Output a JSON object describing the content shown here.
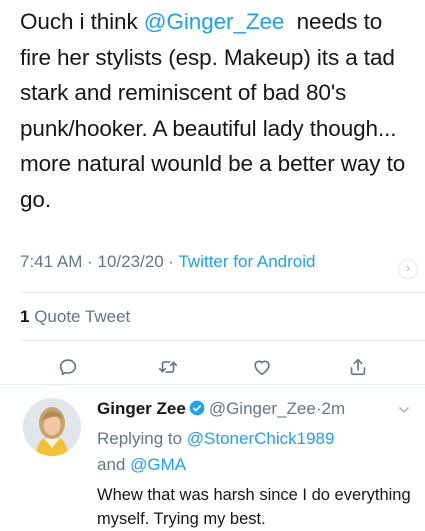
{
  "tweet": {
    "text_line1_pre": "Ouch i think ",
    "mention": "@Ginger_Zee",
    "text_line1_post": "  needs",
    "text_rest": "to fire her stylists (esp. Makeup) its a tad stark and reminiscent of bad 80's punk/hooker. A beautiful lady though... more natural wounld be a better way to go.",
    "time": "7:41 AM",
    "sep1": " · ",
    "date": "10/23/20",
    "sep2": " · ",
    "source": "Twitter for Android",
    "quote_count": "1",
    "quote_label": " Quote Tweet"
  },
  "actions": [
    {
      "name": "reply",
      "icon": "speech-bubble-icon"
    },
    {
      "name": "retweet",
      "icon": "retweet-icon"
    },
    {
      "name": "like",
      "icon": "heart-icon"
    },
    {
      "name": "share",
      "icon": "share-icon"
    }
  ],
  "reply": {
    "name": "Ginger Zee",
    "handle": "@Ginger_Zee",
    "dot": "·",
    "age": "2m",
    "replying_prefix": "Replying to ",
    "replying_user1": "@StonerChick1989",
    "replying_and": "and ",
    "replying_user2": "@GMA",
    "text": "Whew that was harsh since I do everything myself. Trying my best."
  },
  "colors": {
    "link": "#1da1f2",
    "secondary": "#657786",
    "primary": "#14171a",
    "divider": "#e6ecf0"
  }
}
